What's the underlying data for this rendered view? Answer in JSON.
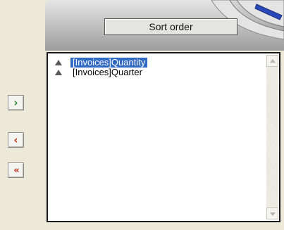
{
  "header": {
    "title": "Sort order"
  },
  "sort_list": {
    "items": [
      {
        "label": "[Invoices]Quantity",
        "icon": "sort-ascending-icon",
        "selected": true
      },
      {
        "label": "[Invoices]Quarter",
        "icon": "sort-ascending-icon",
        "selected": false
      }
    ]
  },
  "buttons": {
    "add_glyph": "›",
    "remove_glyph": "‹",
    "remove_all_glyph": "«"
  },
  "colors": {
    "selection": "#316ac5",
    "add_arrow": "#2f8a2f",
    "remove_arrow": "#c0301c"
  }
}
